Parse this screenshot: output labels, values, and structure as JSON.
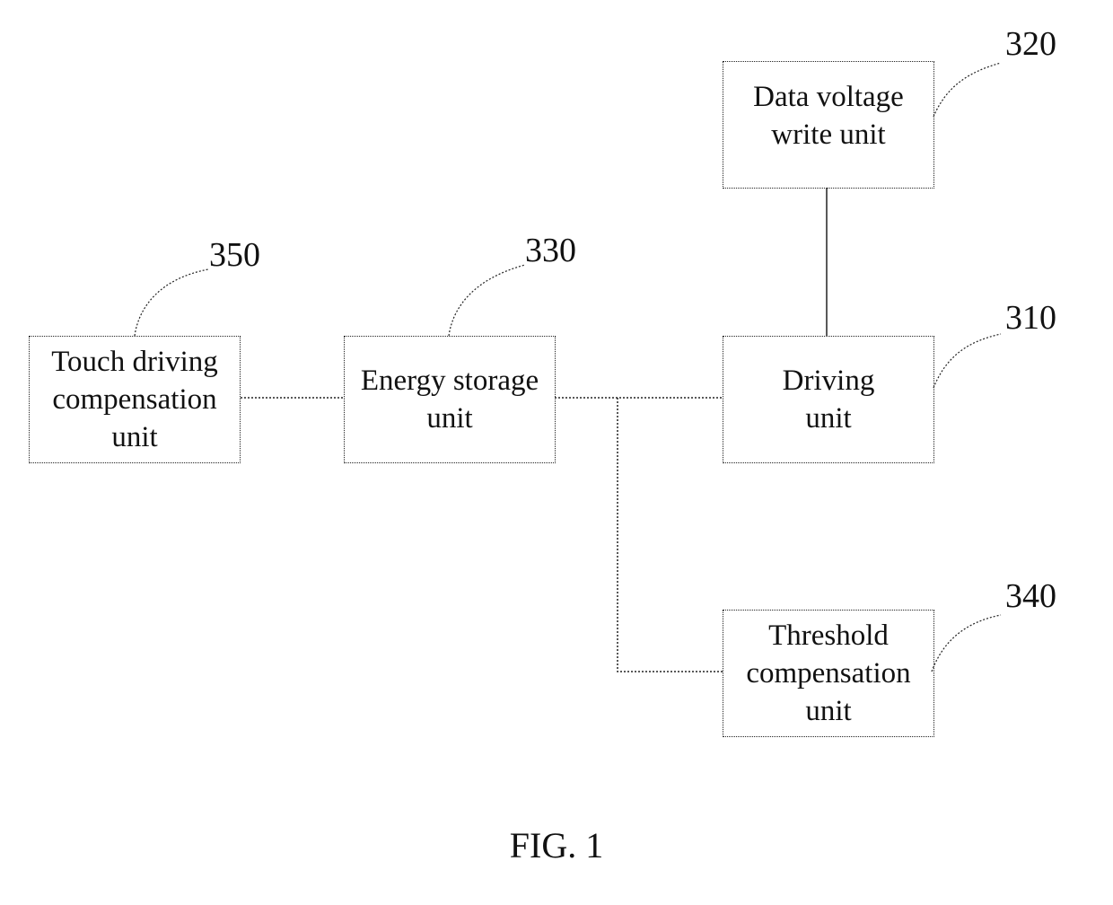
{
  "figure": {
    "caption": "FIG. 1",
    "blocks": [
      {
        "id": "320",
        "label": "Data voltage\nwrite unit"
      },
      {
        "id": "310",
        "label": "Driving\nunit"
      },
      {
        "id": "330",
        "label": "Energy storage\nunit"
      },
      {
        "id": "350",
        "label": "Touch driving\ncompensation\nunit"
      },
      {
        "id": "340",
        "label": "Threshold\ncompensation\nunit"
      }
    ],
    "references": [
      "320",
      "310",
      "330",
      "350",
      "340"
    ],
    "connections": [
      {
        "from": "320",
        "to": "310"
      },
      {
        "from": "350",
        "to": "330"
      },
      {
        "from": "330",
        "to": "310"
      },
      {
        "from": "330",
        "to": "340"
      }
    ]
  }
}
